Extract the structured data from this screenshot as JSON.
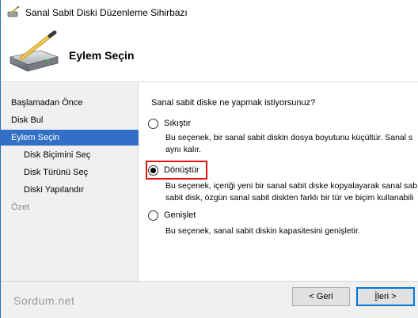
{
  "window": {
    "title": "Sanal Sabit Diski Düzenleme Sihirbazı",
    "page_title": "Eylem Seçin"
  },
  "steps": [
    {
      "label": "Başlamadan Önce",
      "state": "normal"
    },
    {
      "label": "Disk Bul",
      "state": "normal"
    },
    {
      "label": "Eylem Seçin",
      "state": "active"
    },
    {
      "label": "Disk Biçimini Seç",
      "state": "normal"
    },
    {
      "label": "Disk Türünü Seç",
      "state": "normal"
    },
    {
      "label": "Diski Yapılandır",
      "state": "normal"
    },
    {
      "label": "Özet",
      "state": "disabled"
    }
  ],
  "content": {
    "question": "Sanal sabit diske ne yapmak istiyorsunuz?",
    "options": [
      {
        "label": "Sıkıştır",
        "checked": false,
        "description": [
          "Bu seçenek, bir sanal sabit diskin dosya boyutunu küçültür. Sanal s",
          "aynı kalır."
        ]
      },
      {
        "label": "Dönüştür",
        "checked": true,
        "description": [
          "Bu seçenek, içeriği yeni bir sanal sabit diske kopyalayarak sanal sab",
          "sabit disk, özgün sanal sabit diskten farklı bir tür ve biçim kullanabili"
        ]
      },
      {
        "label": "Genişlet",
        "checked": false,
        "description": [
          "Bu seçenek, sanal sabit diskin kapasitesini genişletir."
        ]
      }
    ]
  },
  "footer": {
    "watermark": "Sordum.net",
    "back_label": "< Geri",
    "next_label_pre": "İ",
    "next_label_rest": "leri >"
  },
  "colors": {
    "selection": "#3170c6",
    "highlight_box": "#e01414",
    "panel_bg": "#f0f0f0"
  }
}
